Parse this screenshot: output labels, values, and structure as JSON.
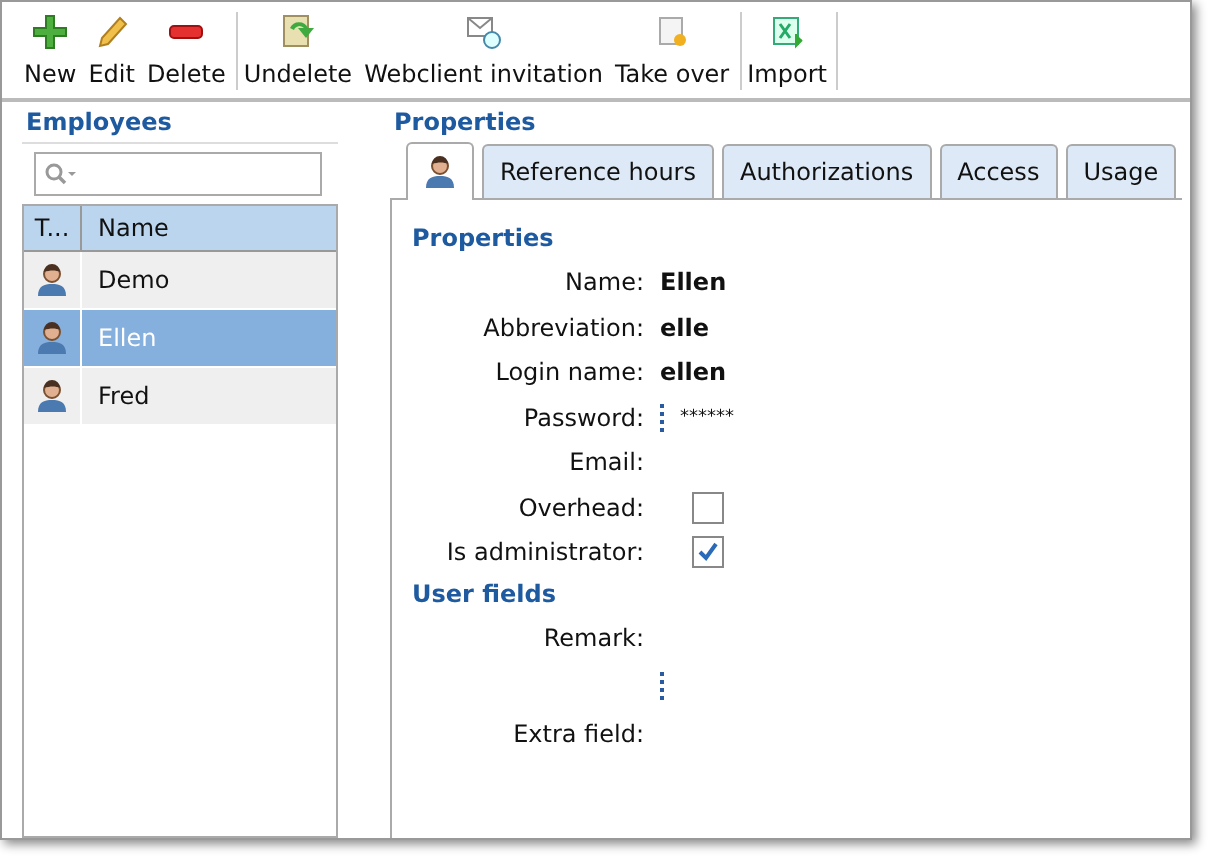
{
  "toolbar": {
    "groups": [
      [
        {
          "label": "New"
        },
        {
          "label": "Edit"
        },
        {
          "label": "Delete"
        }
      ],
      [
        {
          "label": "Undelete"
        },
        {
          "label": "Webclient invitation"
        },
        {
          "label": "Take over"
        }
      ],
      [
        {
          "label": "Import"
        }
      ]
    ]
  },
  "employees": {
    "title": "Employees",
    "columns": [
      "T...",
      "Name"
    ],
    "rows": [
      {
        "name": "Demo",
        "selected": false
      },
      {
        "name": "Ellen",
        "selected": true
      },
      {
        "name": "Fred",
        "selected": false
      }
    ]
  },
  "properties": {
    "title": "Properties",
    "tabs": [
      {
        "kind": "icon",
        "selected": true
      },
      {
        "label": "Reference hours",
        "kind": "text",
        "selected": false
      },
      {
        "label": "Authorizations",
        "kind": "text",
        "selected": false
      },
      {
        "label": "Access",
        "kind": "text",
        "selected": false
      },
      {
        "label": "Usage",
        "kind": "text",
        "selected": false
      }
    ],
    "sections": [
      {
        "title": "Properties",
        "fields": [
          {
            "label": "Name:",
            "kind": "text",
            "value": "Ellen"
          },
          {
            "label": "Abbreviation:",
            "kind": "text",
            "value": "elle"
          },
          {
            "label": "Login name:",
            "kind": "text",
            "value": "ellen"
          },
          {
            "label": "Password:",
            "kind": "password",
            "value": "******"
          },
          {
            "label": "Email:",
            "kind": "text"
          },
          {
            "label": "Overhead:",
            "kind": "checkbox",
            "checked": false
          },
          {
            "label": "Is administrator:",
            "kind": "checkbox",
            "checked": true
          }
        ]
      },
      {
        "title": "User fields",
        "fields": [
          {
            "label": "Remark:",
            "kind": "text"
          },
          {
            "label": "Extra field:",
            "kind": "multiline"
          }
        ]
      }
    ]
  }
}
